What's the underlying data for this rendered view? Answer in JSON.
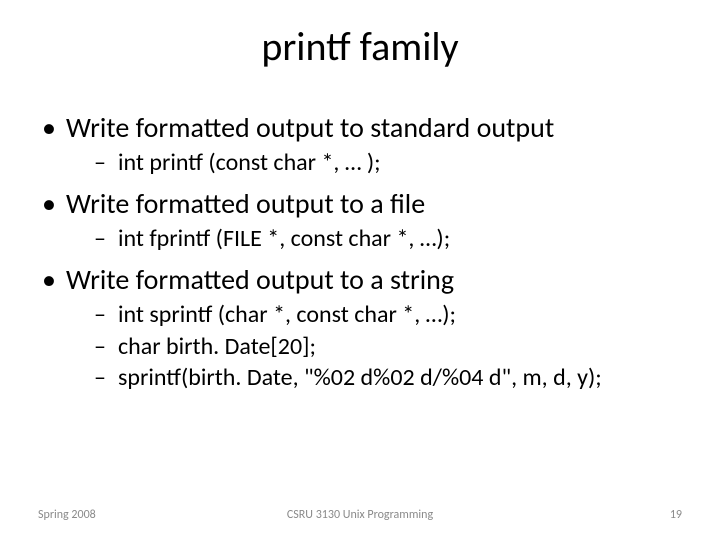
{
  "title": "printf family",
  "bullets": [
    {
      "text": "Write formatted output to standard output",
      "sub": [
        "int printf (const char *, … );"
      ]
    },
    {
      "text": "Write formatted output to a file",
      "sub": [
        "int fprintf (FILE *, const char *, …);"
      ]
    },
    {
      "text": "Write formatted output to a string",
      "sub": [
        "int sprintf (char *, const char *, …);",
        "char birth. Date[20];",
        "sprintf(birth. Date, \"%02 d%02 d/%04 d\", m, d, y);"
      ]
    }
  ],
  "footer": {
    "left": "Spring 2008",
    "center": "CSRU 3130 Unix Programming",
    "right": "19"
  }
}
